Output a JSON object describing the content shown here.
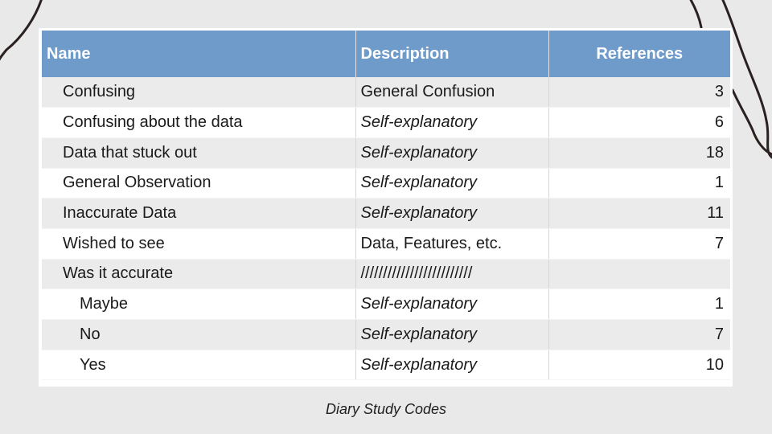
{
  "table": {
    "headers": {
      "name": "Name",
      "description": "Description",
      "references": "References"
    },
    "rows": [
      {
        "name": "Confusing",
        "description": "General Confusion",
        "references": "3",
        "italic": false,
        "indent": false
      },
      {
        "name": "Confusing about the data",
        "description": "Self-explanatory",
        "references": "6",
        "italic": true,
        "indent": false
      },
      {
        "name": "Data that stuck out",
        "description": "Self-explanatory",
        "references": "18",
        "italic": true,
        "indent": false
      },
      {
        "name": "General Observation",
        "description": "Self-explanatory",
        "references": "1",
        "italic": true,
        "indent": false
      },
      {
        "name": "Inaccurate Data",
        "description": "Self-explanatory",
        "references": "11",
        "italic": true,
        "indent": false
      },
      {
        "name": "Wished to see",
        "description": "Data, Features, etc.",
        "references": "7",
        "italic": false,
        "indent": false
      },
      {
        "name": "Was it accurate",
        "description": "/////////////////////////",
        "references": "",
        "italic": false,
        "indent": false
      },
      {
        "name": "Maybe",
        "description": "Self-explanatory",
        "references": "1",
        "italic": true,
        "indent": true
      },
      {
        "name": "No",
        "description": "Self-explanatory",
        "references": "7",
        "italic": true,
        "indent": true
      },
      {
        "name": "Yes",
        "description": "Self-explanatory",
        "references": "10",
        "italic": true,
        "indent": true
      }
    ]
  },
  "caption": "Diary Study Codes",
  "colors": {
    "header_bg": "#6f9bcb",
    "page_bg": "#e9e9e9",
    "row_alt_bg": "#ebebeb"
  }
}
